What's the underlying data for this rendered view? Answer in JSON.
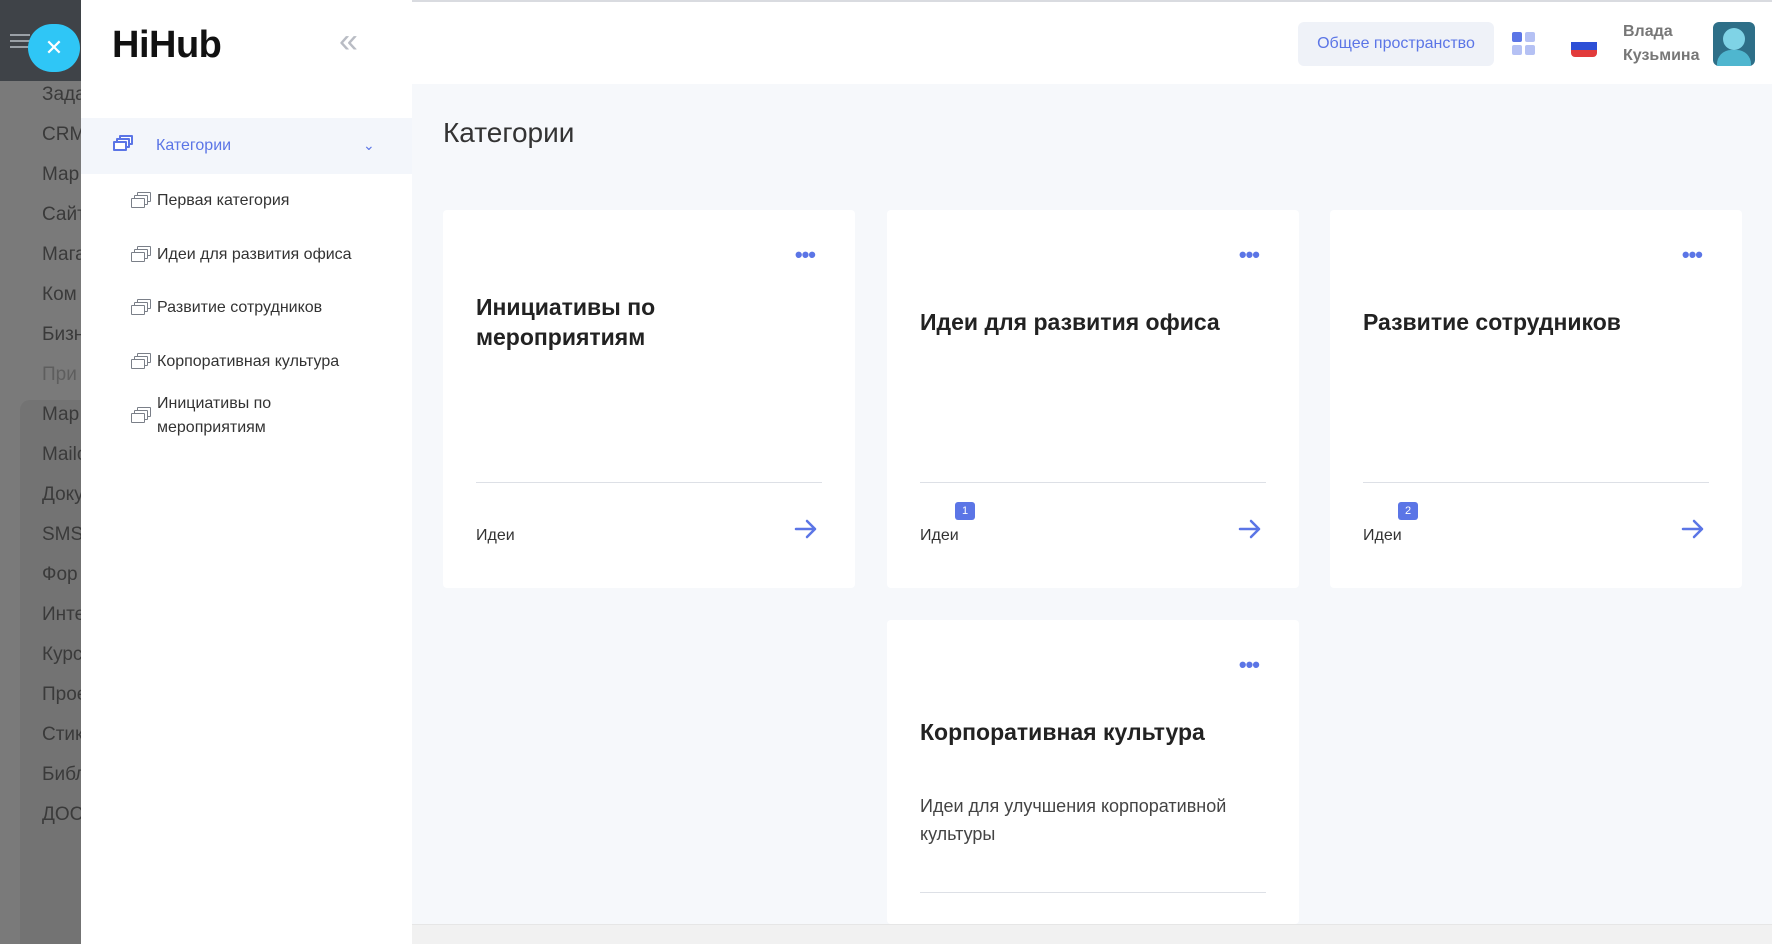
{
  "host_sidebar": {
    "items": [
      "Зада",
      "CRM",
      "Мар",
      "Сайт",
      "Мага",
      "Ком",
      "Бизн",
      "При",
      "Мар",
      "Mailo",
      "Доку",
      "SMS",
      "Фор",
      "Инте",
      "Курс",
      "Прое",
      "Стик",
      "Библ",
      "ДОС"
    ]
  },
  "drawer": {
    "logo": "HiHub",
    "collapse_icon": "double-chevron-left-icon",
    "categories_label": "Категории",
    "subitems": [
      "Первая категория",
      "Идеи для развития офиса",
      "Развитие сотрудников",
      "Корпоративная культура",
      "Инициативы по мероприятиям"
    ]
  },
  "header": {
    "space_button": "Общее пространство",
    "user_name_first": "Влада",
    "user_name_last": "Кузьмина",
    "flag_colors": [
      "#ffffff",
      "#2d4fd6",
      "#e23b3b"
    ]
  },
  "main": {
    "title": "Категории",
    "cards": [
      {
        "title": "Инициативы по мероприятиям",
        "description": "",
        "footer": "Идеи",
        "badge": ""
      },
      {
        "title": "Идеи для развития офиса",
        "description": "",
        "footer": "Идеи",
        "badge": "1"
      },
      {
        "title": "Развитие сотрудников",
        "description": "",
        "footer": "Идеи",
        "badge": "2"
      },
      {
        "title": "Корпоративная культура",
        "description": "Идеи для улучшения корпоративной культуры",
        "footer": "",
        "badge": ""
      }
    ]
  },
  "colors": {
    "accent": "#5b75e6"
  }
}
